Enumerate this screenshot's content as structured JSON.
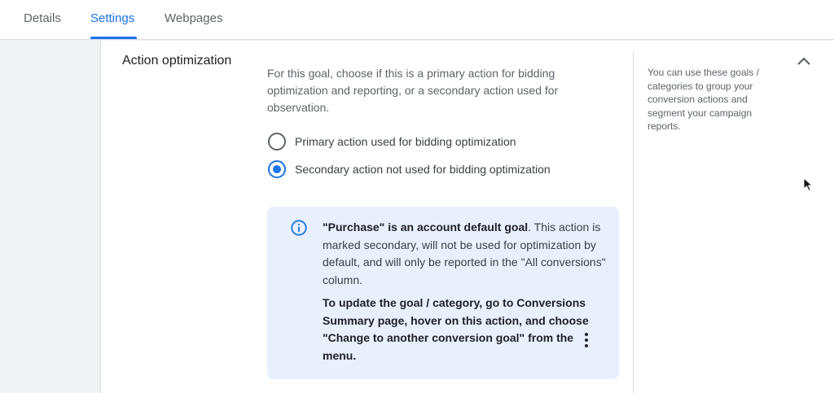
{
  "tabs": [
    {
      "label": "Details",
      "active": false
    },
    {
      "label": "Settings",
      "active": true
    },
    {
      "label": "Webpages",
      "active": false
    }
  ],
  "section": {
    "title": "Action optimization",
    "description": "For this goal, choose if this is a primary action for bidding optimization and reporting, or a secondary action used for observation.",
    "options": [
      {
        "label": "Primary action used for bidding optimization",
        "checked": false
      },
      {
        "label": "Secondary action not used for bidding optimization",
        "checked": true
      }
    ]
  },
  "info": {
    "bold_lead": "\"Purchase\" is an account default goal",
    "text_rest": ". This action is marked secondary, will not be used for optimization by default, and will only be reported in the \"All conversions\" column.",
    "instruction": "To update the goal / category, go to Conversions Summary page, hover on this action, and choose \"Change to another conversion goal\" from the",
    "instruction_end": "menu."
  },
  "side_help": "You can use these goals / categories to group your conversion actions and segment your campaign reports.",
  "icons": {
    "info": "info-icon",
    "kebab": "more-vert-icon",
    "collapse": "chevron-up-icon",
    "cursor": "mouse-pointer-icon"
  },
  "colors": {
    "accent": "#1a73e8",
    "info_bg": "#e8f0fe"
  }
}
